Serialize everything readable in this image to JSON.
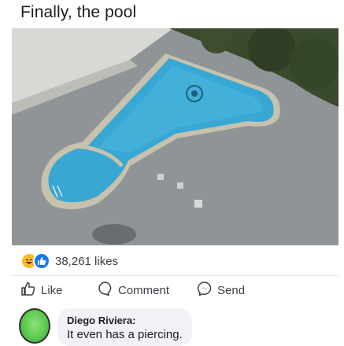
{
  "post": {
    "title": "Finally, the pool"
  },
  "icons": {
    "haha": "haha-reaction-icon",
    "like": "like-reaction-icon",
    "thumbs_up": "thumbs-up-icon",
    "comment": "comment-bubble-icon",
    "send": "messenger-send-icon"
  },
  "colors": {
    "like_blue": "#1877f2",
    "haha_yellow": "#f7b928",
    "pool_water": "#39a7d3"
  },
  "reactions": {
    "count_text": "38,261 likes"
  },
  "actions": {
    "like_label": "Like",
    "comment_label": "Comment",
    "send_label": "Send"
  },
  "comment": {
    "author": "Diego Riviera:",
    "text": "It even has a piercing."
  }
}
